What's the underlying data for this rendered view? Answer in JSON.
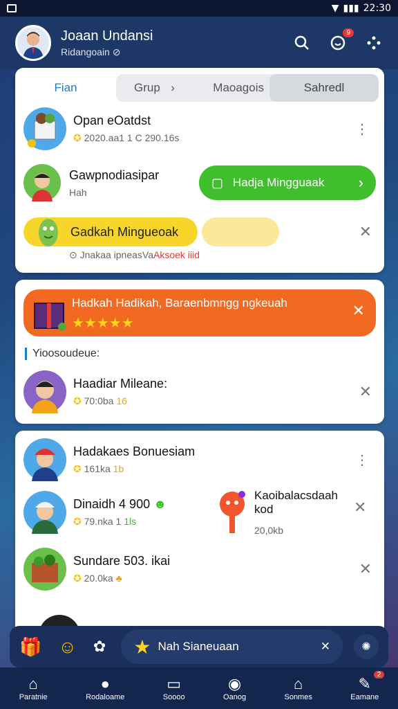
{
  "status": {
    "time": "22:30"
  },
  "header": {
    "name": "Joaan Undansi",
    "sub": "Ridangoain",
    "notif_badge": "9"
  },
  "tabs": {
    "first": "Fian",
    "group": "Grup",
    "middle": "Maoagois",
    "selected": "Sahredl"
  },
  "section1": {
    "item1": {
      "title": "Opan eOatdst",
      "meta": "2020.aa1 1 C 290.16s"
    },
    "item2": {
      "title": "Gawpnodiasipar",
      "sub": "Hah",
      "button": "Hadja Mingguaak"
    },
    "item3": {
      "pill": "Gadkah Mingueoak",
      "meta": "Jnakaa ipneasVa",
      "meta_red": "Aksoek iiid"
    }
  },
  "banner": {
    "title": "Hadkah Hadikah, Baraenbmngg ngkeuah",
    "stars": "★★★★★"
  },
  "section2": {
    "label": "Yioosoudeue:",
    "item1": {
      "title": "Haadiar Mileane:",
      "meta": "70:0ba",
      "meta2": "16"
    }
  },
  "section3": {
    "item1": {
      "title": "Hadakaes Bonuesiam",
      "meta": "161ka",
      "meta2": "1b"
    },
    "item2": {
      "title": "Dinaidh 4 900",
      "meta": "79.nka 1",
      "meta2": "1ls"
    },
    "side": {
      "title": "Kaoibalacsdaah kod",
      "meta": "20,0kb"
    },
    "item3": {
      "title": "Sundare 503. ikai",
      "meta": "20.0ka"
    }
  },
  "bottom_bar": {
    "search": "Nah Sianeuaan"
  },
  "nav": {
    "items": [
      {
        "label": "Paratnie",
        "icon": "home-icon"
      },
      {
        "label": "Rodaloame",
        "icon": "apple-icon"
      },
      {
        "label": "Soooo",
        "icon": "card-icon"
      },
      {
        "label": "Oanog",
        "icon": "chat-icon"
      },
      {
        "label": "Sonmes",
        "icon": "store-icon"
      },
      {
        "label": "Eamane",
        "icon": "edit-icon",
        "badge": "2"
      }
    ]
  }
}
